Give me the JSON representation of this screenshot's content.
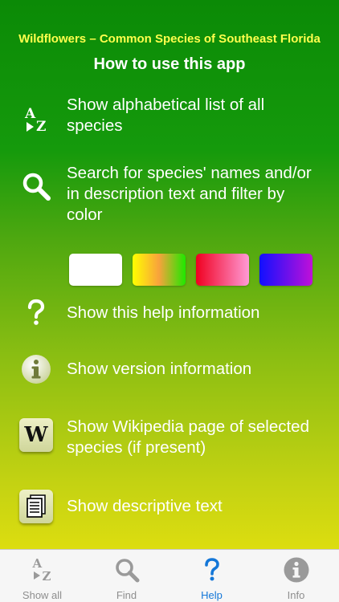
{
  "header": {
    "app_title": "Wildflowers – Common Species of Southeast Florida",
    "page_title": "How to use this app"
  },
  "help_items": [
    {
      "icon": "az-list-icon",
      "text": "Show alphabetical list of all species"
    },
    {
      "icon": "search-icon",
      "text": "Search for species' names and/or in description text and filter by color"
    },
    {
      "icon": "question-icon",
      "text": "Show this help information"
    },
    {
      "icon": "info-icon",
      "text": "Show version information"
    },
    {
      "icon": "wikipedia-icon",
      "text": "Show Wikipedia page of selected species (if present)"
    },
    {
      "icon": "document-icon",
      "text": "Show descriptive text"
    }
  ],
  "color_filters": [
    {
      "name": "white",
      "color": "#ffffff"
    },
    {
      "name": "yellow-orange-green",
      "color": "#ffff00"
    },
    {
      "name": "red-pink",
      "color": "#f00020"
    },
    {
      "name": "blue-purple",
      "color": "#1010ff"
    }
  ],
  "wikipedia_glyph": "W",
  "az_glyphs": {
    "a": "A",
    "z": "Z"
  },
  "tabs": [
    {
      "label": "Show all",
      "icon": "az-list-icon",
      "active": false
    },
    {
      "label": "Find",
      "icon": "search-icon",
      "active": false
    },
    {
      "label": "Help",
      "icon": "question-icon",
      "active": true
    },
    {
      "label": "Info",
      "icon": "info-icon",
      "active": false
    }
  ],
  "colors": {
    "accent_active": "#1477d8",
    "title_yellow": "#ffff4d",
    "tab_inactive": "#8e8e8e"
  }
}
